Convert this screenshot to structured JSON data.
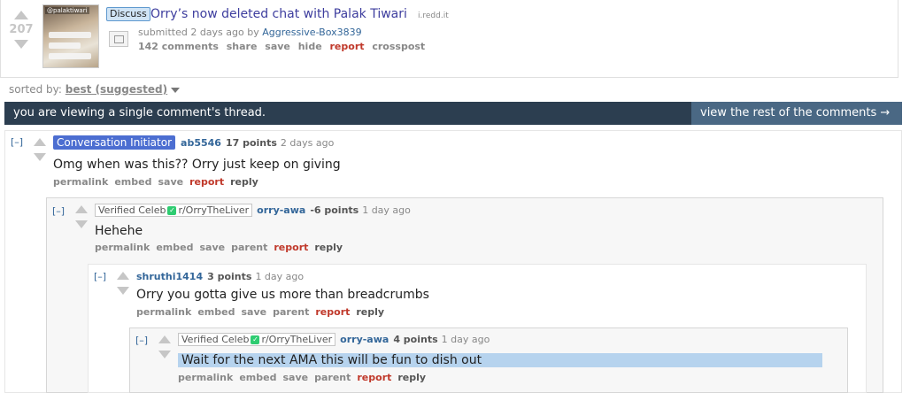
{
  "post": {
    "score": "207",
    "thumb_tag": "@palaktiwari",
    "flair": "Discuss",
    "title": "Orry’s now deleted chat with Palak Tiwari",
    "domain": "i.redd.it",
    "submitted_prefix": "submitted 2 days ago by",
    "author": "Aggressive-Box3839",
    "buttons": [
      "142 comments",
      "share",
      "save",
      "hide",
      "report",
      "crosspost"
    ]
  },
  "sort": {
    "label": "sorted by:",
    "value": "best (suggested)"
  },
  "banner": {
    "left": "you are viewing a single comment's thread.",
    "right": "view the rest of the comments →"
  },
  "comments": [
    {
      "toggle": "[–]",
      "flair": "Conversation Initiator",
      "user": "ab5546",
      "points": "17 points",
      "time": "2 days ago",
      "body": "Omg when was this?? Orry just keep on giving",
      "buttons": [
        "permalink",
        "embed",
        "save",
        "report",
        "reply"
      ]
    },
    {
      "toggle": "[–]",
      "flair_left": "Verified Celeb",
      "flair_right": "r/OrryTheLiver",
      "user": "orry-awa",
      "points": "-6 points",
      "time": "1 day ago",
      "body": "Hehehe",
      "buttons": [
        "permalink",
        "embed",
        "save",
        "parent",
        "report",
        "reply"
      ]
    },
    {
      "toggle": "[–]",
      "user": "shruthi1414",
      "points": "3 points",
      "time": "1 day ago",
      "body": "Orry you gotta give us more than breadcrumbs",
      "buttons": [
        "permalink",
        "embed",
        "save",
        "parent",
        "report",
        "reply"
      ]
    },
    {
      "toggle": "[–]",
      "flair_left": "Verified Celeb",
      "flair_right": "r/OrryTheLiver",
      "user": "orry-awa",
      "points": "4 points",
      "time": "1 day ago",
      "body": "Wait for the next AMA this will be fun to dish out",
      "buttons": [
        "permalink",
        "embed",
        "save",
        "parent",
        "report",
        "reply"
      ]
    }
  ]
}
